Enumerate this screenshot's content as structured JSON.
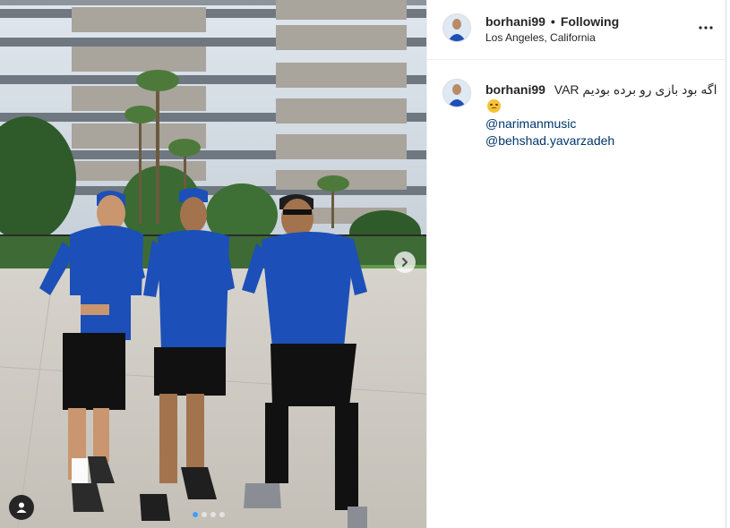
{
  "post": {
    "username": "borhani99",
    "separator": "•",
    "follow_status": "Following",
    "location": "Los Angeles, California",
    "caption_text": "اگه بود بازی رو برده بودیم VAR",
    "caption_emoji": "disappointed-face-icon",
    "mentions": [
      "@narimanmusic",
      "@behshad.yavarzadeh"
    ]
  },
  "carousel": {
    "slide_count": 4,
    "active_index": 0,
    "next_icon": "chevron-right-icon",
    "tag_icon": "user-tag-icon"
  },
  "colors": {
    "accent_dot": "#3f9ef7",
    "mention": "#00376b",
    "jersey": "#1c4fb8"
  }
}
